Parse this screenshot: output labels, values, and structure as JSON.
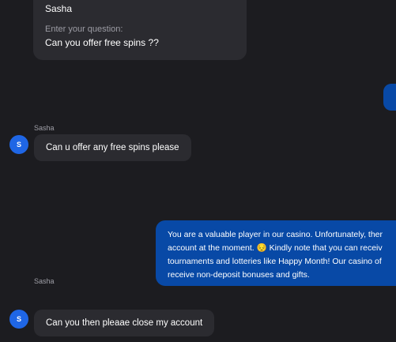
{
  "form_card": {
    "name": "Sasha",
    "question_label": "Enter your question:",
    "question_value": "Can you offer free spins ??"
  },
  "messages": [
    {
      "sender": "Sasha",
      "avatar_letter": "S",
      "text": "Can u offer any free spins please"
    },
    {
      "lines": [
        "You are a valuable player in our casino. Unfortunately, ther",
        "account at the moment. 😔 Kindly note that you can receiv",
        "tournaments and lotteries like Happy Month! Our casino of",
        "receive non-deposit bonuses and gifts."
      ]
    },
    {
      "sender": "Sasha",
      "avatar_letter": "S",
      "text": "Can you then pleaae close my account"
    }
  ],
  "colors": {
    "background": "#1c1c20",
    "incoming_bubble": "#2b2b30",
    "outgoing_bubble": "#0849a6",
    "avatar": "#1f66e5"
  }
}
